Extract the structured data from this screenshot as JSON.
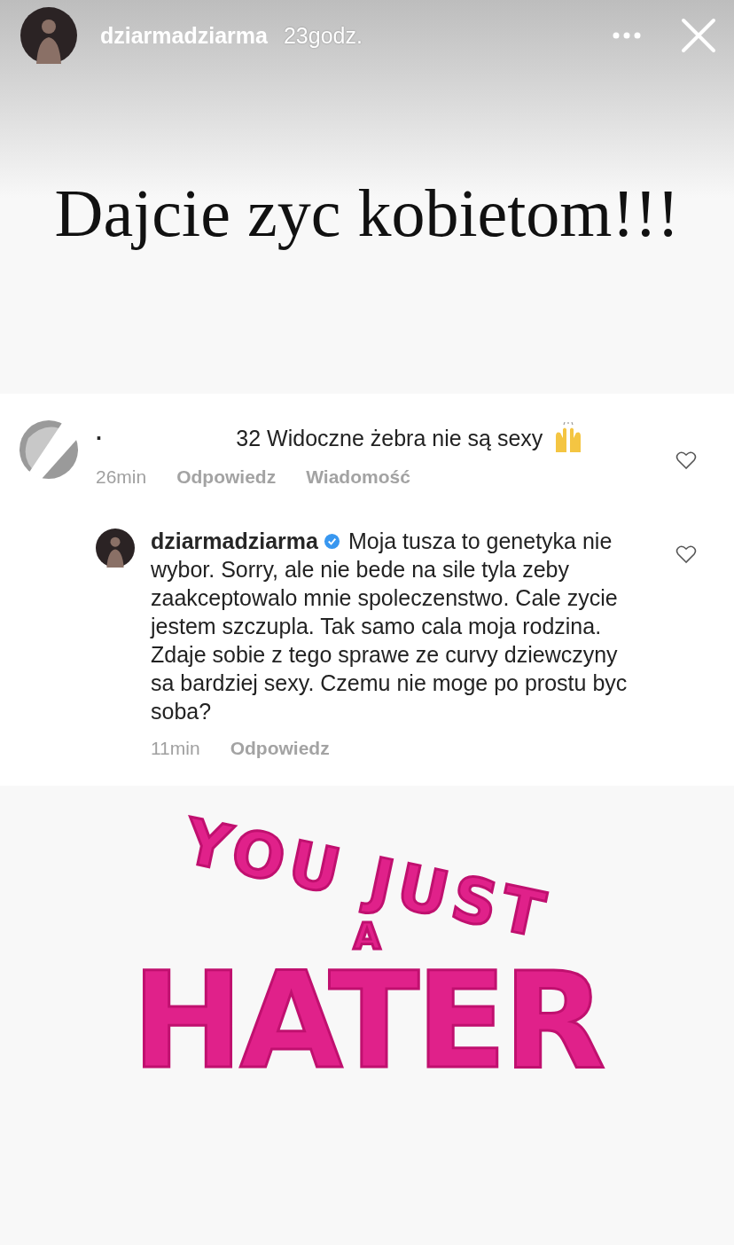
{
  "story_header": {
    "username": "dziarmadziarma",
    "time": "23godz."
  },
  "headline": "Dajcie zyc kobietom!!!",
  "comments": [
    {
      "username": "·",
      "verified": false,
      "text": "32 Widoczne żebra nie są sexy",
      "liked": false,
      "time": "26min",
      "actions": [
        "Odpowiedz",
        "Wiadomość"
      ],
      "children": [
        {
          "username": "dziarmadziarma",
          "verified": true,
          "text": "Moja tusza to genetyka nie wybor. Sorry, ale nie bede na sile tyla zeby zaakceptowalo mnie spoleczenstwo. Cale zycie jestem szczupla. Tak samo cala moja rodzina. Zdaje sobie z tego sprawe ze curvy dziewczyny sa bardziej sexy. Czemu nie moge po prostu byc soba?",
          "liked": false,
          "time": "11min",
          "actions": [
            "Odpowiedz"
          ]
        }
      ]
    }
  ],
  "sticker": {
    "lines": [
      "YOU JUST",
      "A",
      "HATER"
    ]
  }
}
